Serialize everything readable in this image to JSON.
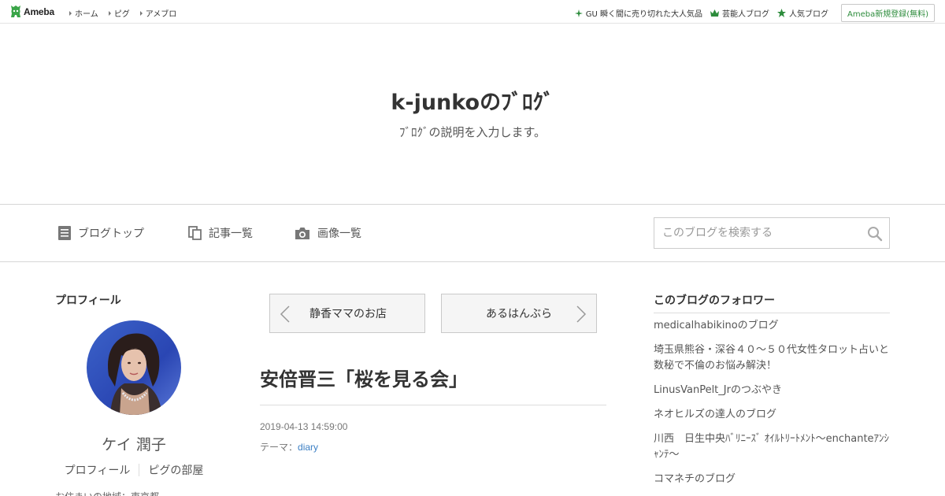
{
  "topbar": {
    "logo_text": "Ameba",
    "nav": [
      {
        "label": "ホーム"
      },
      {
        "label": "ピグ"
      },
      {
        "label": "アメブロ"
      }
    ],
    "right_links": [
      {
        "label": "GU 瞬く間に売り切れた大人気品",
        "icon": "sparkle-icon"
      },
      {
        "label": "芸能人ブログ",
        "icon": "crown-icon"
      },
      {
        "label": "人気ブログ",
        "icon": "star-icon"
      }
    ],
    "register_label": "Ameba新規登録(無料)",
    "accent_color": "#2d8c3c"
  },
  "header": {
    "title": "k-junkoのﾌﾞﾛｸﾞ",
    "description": "ﾌﾞﾛｸﾞの説明を入力します。"
  },
  "nav": {
    "items": [
      {
        "label": "ブログトップ",
        "icon": "document-icon"
      },
      {
        "label": "記事一覧",
        "icon": "copy-icon"
      },
      {
        "label": "画像一覧",
        "icon": "camera-icon"
      }
    ],
    "search_placeholder": "このブログを検索する"
  },
  "profile": {
    "heading": "プロフィール",
    "name": "ケイ 潤子",
    "links": [
      "プロフィール",
      "ピグの部屋"
    ],
    "more_text": "お住まいの地域：東京都"
  },
  "pager": {
    "prev_label": "静香ママのお店",
    "next_label": "あるはんぶら"
  },
  "entry": {
    "title": "安倍晋三「桜を見る会」",
    "date": "2019-04-13 14:59:00",
    "theme_prefix": "テーマ：",
    "theme": "diary"
  },
  "followers": {
    "heading": "このブログのフォロワー",
    "items": [
      "medicalhabikinoのブログ",
      "埼玉県熊谷・深谷４０～５０代女性タロット占いと数秘で不倫のお悩み解決！",
      "LinusVanPelt_Jrのつぶやき",
      "ネオヒルズの達人のブログ",
      "川西　日生中央ﾊﾞﾘﾆｰｽﾞ ｵｲﾙﾄﾘｰﾄﾒﾝﾄ〜enchanteｱﾝｼｬﾝﾃ〜",
      "コマネチのブログ"
    ]
  }
}
